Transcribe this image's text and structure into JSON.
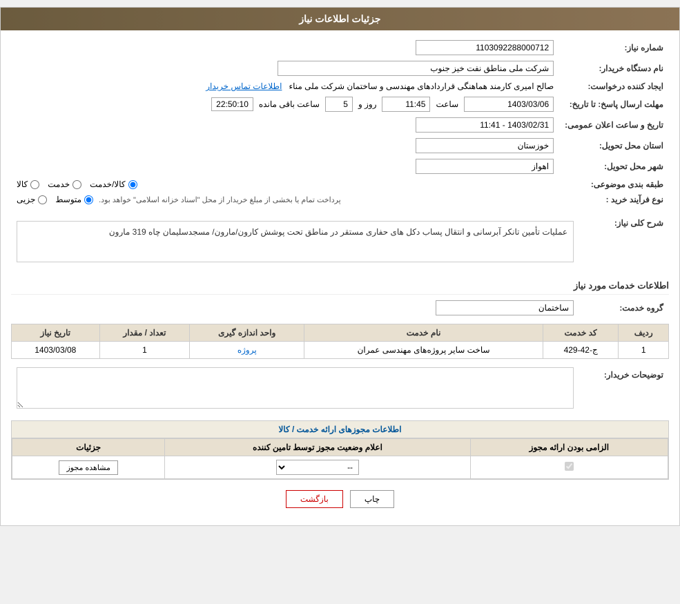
{
  "header": {
    "title": "جزئیات اطلاعات نیاز"
  },
  "fields": {
    "need_number_label": "شماره نیاز:",
    "need_number_value": "1103092288000712",
    "buyer_org_label": "نام دستگاه خریدار:",
    "buyer_org_value": "شرکت ملی مناطق نفت خیز جنوب",
    "creator_label": "ایجاد کننده درخواست:",
    "creator_value": "صالح امیری کارمند هماهنگی قراردادهای مهندسی و ساختمان شرکت ملی مناء",
    "contact_link": "اطلاعات تماس خریدار",
    "deadline_label": "مهلت ارسال پاسخ: تا تاریخ:",
    "deadline_date": "1403/03/06",
    "deadline_time_label": "ساعت",
    "deadline_time": "11:45",
    "deadline_days_label": "روز و",
    "deadline_days": "5",
    "countdown_label": "ساعت باقی مانده",
    "countdown_value": "22:50:10",
    "announce_label": "تاریخ و ساعت اعلان عمومی:",
    "announce_value": "1403/02/31 - 11:41",
    "province_label": "استان محل تحویل:",
    "province_value": "خوزستان",
    "city_label": "شهر محل تحویل:",
    "city_value": "اهواز",
    "category_label": "طبقه بندی موضوعی:",
    "category_kala": "کالا",
    "category_khedmat": "خدمت",
    "category_kala_khedmat": "کالا/خدمت",
    "purchase_type_label": "نوع فرآیند خرید :",
    "purchase_jozii": "جزیی",
    "purchase_motovaset": "متوسط",
    "purchase_note": "پرداخت تمام یا بخشی از مبلغ خریدار از محل \"اسناد خزانه اسلامی\" خواهد بود.",
    "description_label": "شرح کلی نیاز:",
    "description_value": "عملیات تأمین تانکر آبرسانی و انتقال پساب دکل های حفاری مستقر در مناطق تحت پوشش کارون/مارون/ مسجدسلیمان چاه 319 مارون",
    "services_section_title": "اطلاعات خدمات مورد نیاز",
    "service_group_label": "گروه خدمت:",
    "service_group_value": "ساختمان",
    "table": {
      "columns": [
        "ردیف",
        "کد خدمت",
        "نام خدمت",
        "واحد اندازه گیری",
        "تعداد / مقدار",
        "تاریخ نیاز"
      ],
      "rows": [
        [
          "1",
          "ج-42-429",
          "ساخت سایر پروژه‌های مهندسی عمران",
          "پروژه",
          "1",
          "1403/03/08"
        ]
      ]
    },
    "buyer_notes_label": "توضیحات خریدار:",
    "buyer_notes_value": "",
    "permissions_section_title": "اطلاعات مجوزهای ارائه خدمت / کالا",
    "permissions_table": {
      "columns": [
        "الزامی بودن ارائه مجوز",
        "اعلام وضعیت مجوز توسط نامین کننده",
        "جزئیات"
      ],
      "rows": [
        [
          "✓",
          "--",
          "مشاهده مجوز"
        ]
      ]
    },
    "select_placeholder": "--",
    "btn_print": "چاپ",
    "btn_back": "بازگشت"
  }
}
